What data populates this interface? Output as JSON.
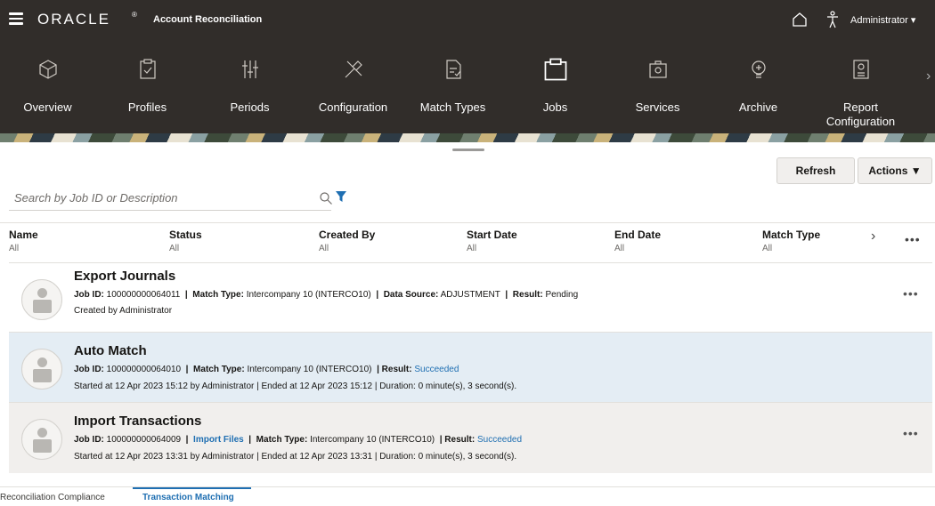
{
  "header": {
    "brand": "ORACLE",
    "brand_mark": "®",
    "app_title": "Account Reconciliation",
    "user_label": "Administrator ▾"
  },
  "nav": {
    "items": [
      {
        "label": "Overview",
        "icon": "overview-icon"
      },
      {
        "label": "Profiles",
        "icon": "profiles-icon"
      },
      {
        "label": "Periods",
        "icon": "periods-icon"
      },
      {
        "label": "Configuration",
        "icon": "configuration-icon"
      },
      {
        "label": "Match Types",
        "icon": "match-types-icon"
      },
      {
        "label": "Jobs",
        "icon": "jobs-icon"
      },
      {
        "label": "Services",
        "icon": "services-icon"
      },
      {
        "label": "Archive",
        "icon": "archive-icon"
      },
      {
        "label": "Report Configuration",
        "icon": "report-configuration-icon"
      }
    ],
    "active": "Jobs"
  },
  "toolbar": {
    "refresh_label": "Refresh",
    "actions_label": "Actions ▼"
  },
  "search": {
    "placeholder": "Search by Job ID or Description",
    "value": ""
  },
  "columns": [
    {
      "name": "Name",
      "filter": "All"
    },
    {
      "name": "Status",
      "filter": "All"
    },
    {
      "name": "Created By",
      "filter": "All"
    },
    {
      "name": "Start Date",
      "filter": "All"
    },
    {
      "name": "End Date",
      "filter": "All"
    },
    {
      "name": "Match Type",
      "filter": "All"
    }
  ],
  "jobs": [
    {
      "title": "Export Journals",
      "job_id_label": "Job ID:",
      "job_id": "100000000064011",
      "match_type_label": "Match Type:",
      "match_type": "Intercompany 10 (INTERCO10)",
      "data_source_label": "Data Source:",
      "data_source": "ADJUSTMENT",
      "result_label": "Result:",
      "result": "Pending",
      "sub": "Created by Administrator"
    },
    {
      "title": "Auto Match",
      "job_id_label": "Job ID:",
      "job_id": "100000000064010",
      "match_type_label": "Match Type:",
      "match_type": "Intercompany 10 (INTERCO10)",
      "result_label": "Result:",
      "result": "Succeeded",
      "sub": "Started at 12 Apr 2023 15:12 by Administrator  | Ended at 12 Apr 2023 15:12 | Duration: 0 minute(s), 3 second(s)."
    },
    {
      "title": "Import Transactions",
      "job_id_label": "Job ID:",
      "job_id": "100000000064009",
      "link": "Import Files",
      "match_type_label": "Match Type:",
      "match_type": "Intercompany 10 (INTERCO10)",
      "result_label": "Result:",
      "result": "Succeeded",
      "sub": "Started at 12 Apr 2023 13:31 by Administrator  | Ended at 12 Apr 2023 13:31 | Duration: 0 minute(s), 3 second(s)."
    }
  ],
  "bottom_tabs": [
    {
      "label": "Reconciliation Compliance"
    },
    {
      "label": "Transaction Matching"
    }
  ],
  "colors": {
    "header_bg": "#312d2a",
    "accent": "#1f6fb2",
    "selected_row": "#e4edf4"
  }
}
